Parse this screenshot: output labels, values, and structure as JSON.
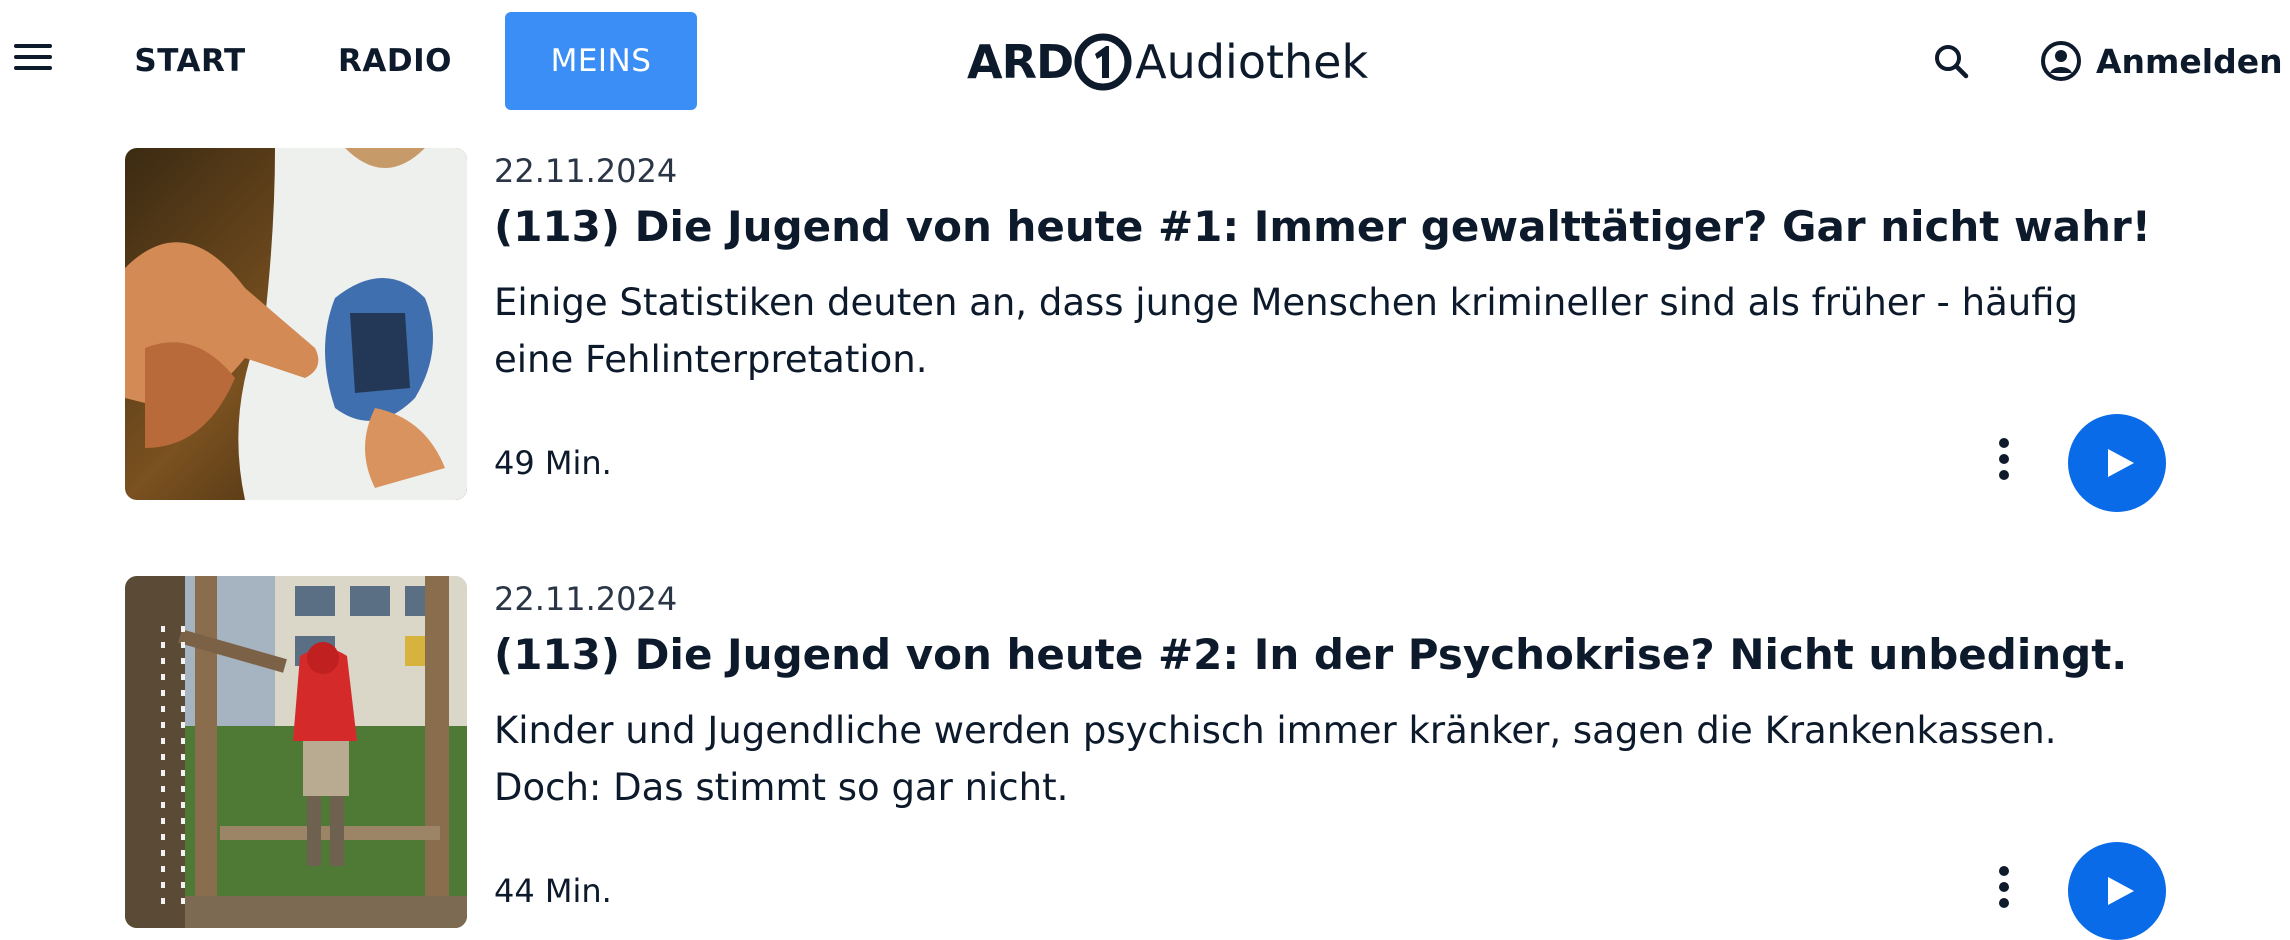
{
  "header": {
    "menu_icon": "hamburger-menu-icon",
    "tabs": [
      {
        "label": "START",
        "active": false
      },
      {
        "label": "RADIO",
        "active": false
      },
      {
        "label": "MEINS",
        "active": true
      }
    ],
    "logo": {
      "ard": "ARD",
      "name": "Audiothek"
    },
    "search_icon": "search-icon",
    "login": {
      "icon": "user-circle-icon",
      "label": "Anmelden"
    }
  },
  "episodes": [
    {
      "date": "22.11.2024",
      "title": "(113) Die Jugend von heute #1: Immer gewalttätiger? Gar nicht wahr!",
      "description": "Einige Statistiken deuten an, dass junge Menschen krimineller sind als früher - häufig eine Fehlinterpretation.",
      "duration": "49 Min."
    },
    {
      "date": "22.11.2024",
      "title": "(113) Die Jugend von heute #2: In der Psychokrise? Nicht unbedingt.",
      "description": "Kinder und Jugendliche werden psychisch immer kränker, sagen die Krankenkassen. Doch: Das stimmt so gar nicht.",
      "duration": "44 Min."
    }
  ],
  "colors": {
    "accent": "#3a8ef6",
    "play_button": "#0a6be8",
    "text": "#0d1a2b"
  }
}
